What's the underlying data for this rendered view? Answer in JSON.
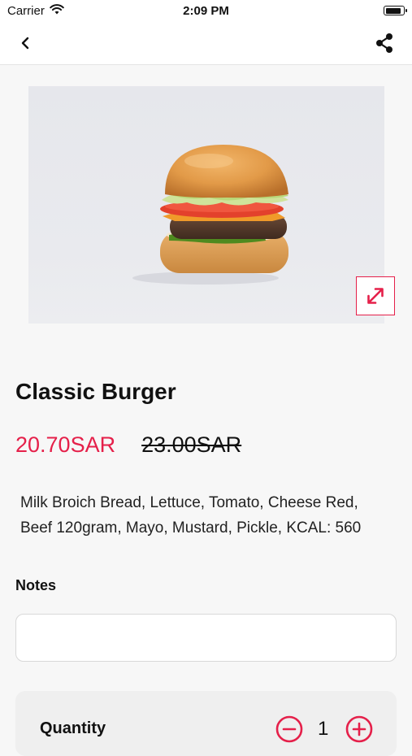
{
  "status_bar": {
    "carrier": "Carrier",
    "time": "2:09 PM",
    "wifi_icon": "wifi-icon",
    "battery_icon": "battery-icon",
    "battery_level": 0.9
  },
  "nav": {
    "back_icon": "chevron-left-icon",
    "share_icon": "share-icon"
  },
  "product": {
    "image_alt": "burger",
    "expand_icon": "expand-icon",
    "title": "Classic Burger",
    "price": "20.70SAR",
    "old_price": "23.00SAR",
    "description": "Milk Broich Bread, Lettuce, Tomato, Cheese Red, Beef 120gram, Mayo, Mustard, Pickle, KCAL: 560"
  },
  "notes": {
    "label": "Notes",
    "value": "",
    "placeholder": ""
  },
  "quantity": {
    "label": "Quantity",
    "value": "1",
    "minus_icon": "minus-circle-icon",
    "plus_icon": "plus-circle-icon"
  },
  "colors": {
    "accent": "#e5204a",
    "background": "#f7f7f7"
  }
}
